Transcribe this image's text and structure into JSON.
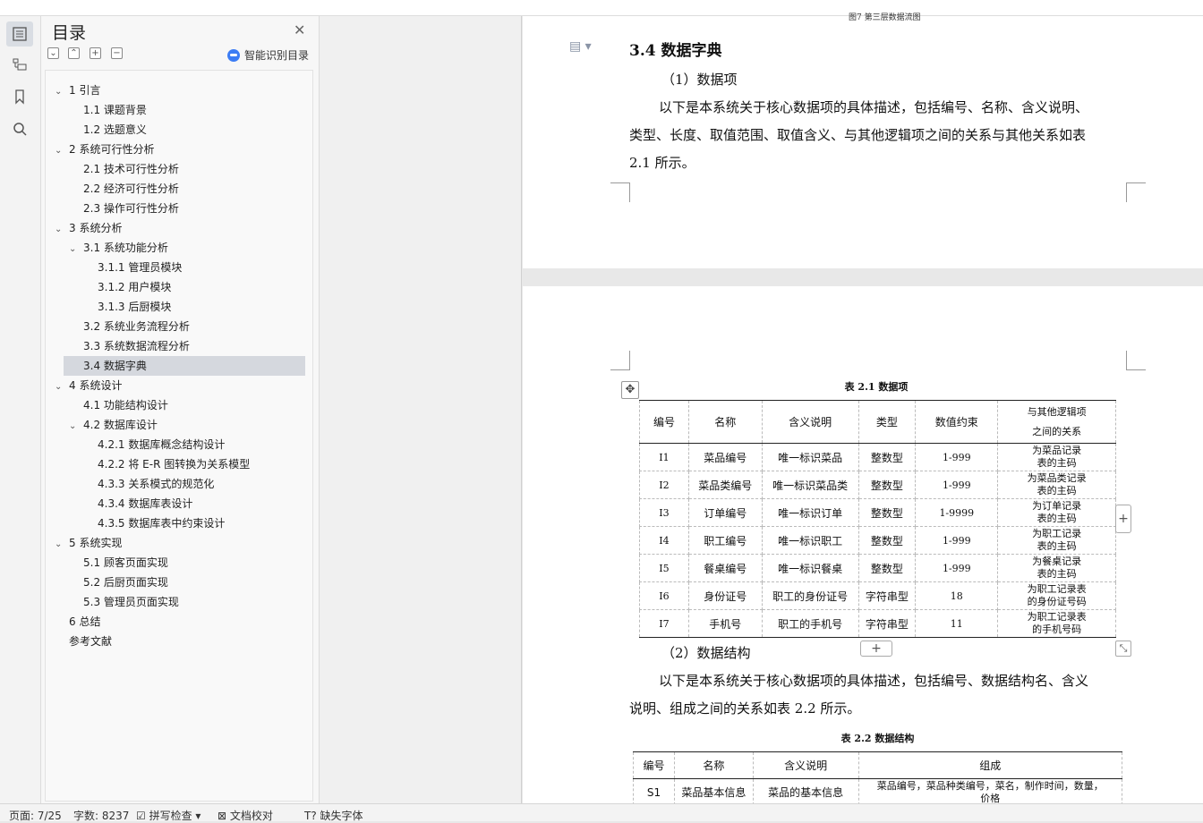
{
  "toc": {
    "title": "目录",
    "smart_label": "智能识别目录",
    "items": [
      {
        "label": "1 引言",
        "level": 1,
        "expanded": true
      },
      {
        "label": "1.1 课题背景",
        "level": 2
      },
      {
        "label": "1.2 选题意义",
        "level": 2
      },
      {
        "label": "2 系统可行性分析",
        "level": 1,
        "expanded": true
      },
      {
        "label": "2.1 技术可行性分析",
        "level": 2
      },
      {
        "label": "2.2 经济可行性分析",
        "level": 2
      },
      {
        "label": "2.3 操作可行性分析",
        "level": 2
      },
      {
        "label": "3 系统分析",
        "level": 1,
        "expanded": true
      },
      {
        "label": "3.1 系统功能分析",
        "level": 2,
        "expanded": true
      },
      {
        "label": "3.1.1 管理员模块",
        "level": 3
      },
      {
        "label": "3.1.2 用户模块",
        "level": 3
      },
      {
        "label": "3.1.3 后厨模块",
        "level": 3
      },
      {
        "label": "3.2 系统业务流程分析",
        "level": 2
      },
      {
        "label": "3.3 系统数据流程分析",
        "level": 2
      },
      {
        "label": "3.4 数据字典",
        "level": 2,
        "selected": true
      },
      {
        "label": "4 系统设计",
        "level": 1,
        "expanded": true
      },
      {
        "label": "4.1 功能结构设计",
        "level": 2
      },
      {
        "label": "4.2 数据库设计",
        "level": 2,
        "expanded": true
      },
      {
        "label": "4.2.1 数据库概念结构设计",
        "level": 3
      },
      {
        "label": "4.2.2 将 E-R 图转换为关系模型",
        "level": 3
      },
      {
        "label": "4.3.3 关系模式的规范化",
        "level": 3
      },
      {
        "label": "4.3.4 数据库表设计",
        "level": 3
      },
      {
        "label": "4.3.5 数据库表中约束设计",
        "level": 3
      },
      {
        "label": "5 系统实现",
        "level": 1,
        "expanded": true
      },
      {
        "label": "5.1 顾客页面实现",
        "level": 2
      },
      {
        "label": "5.2 后厨页面实现",
        "level": 2
      },
      {
        "label": "5.3 管理员页面实现",
        "level": 2
      },
      {
        "label": "6 总结",
        "level": 1
      },
      {
        "label": "参考文献",
        "level": 1
      }
    ]
  },
  "doc": {
    "top_caption": "图7 第三层数据流图",
    "heading": "3.4  数据字典",
    "sub1": "（1）数据项",
    "para1_lines": [
      "以下是本系统关于核心数据项的具体描述，包括编号、名称、含义说明、",
      "类型、长度、取值范围、取值含义、与其他逻辑项之间的关系与其他关系如表",
      "2.1 所示。"
    ],
    "table1_caption": "表 2.1  数据项",
    "table1_headers": [
      "编号",
      "名称",
      "含义说明",
      "类型",
      "数值约束",
      "与其他逻辑项",
      "之间的关系"
    ],
    "table1_rows": [
      [
        "I1",
        "菜品编号",
        "唯一标识菜品",
        "整数型",
        "1-999",
        "为菜品记录",
        "表的主码"
      ],
      [
        "I2",
        "菜品类编号",
        "唯一标识菜品类",
        "整数型",
        "1-999",
        "为菜品类记录",
        "表的主码"
      ],
      [
        "I3",
        "订单编号",
        "唯一标识订单",
        "整数型",
        "1-9999",
        "为订单记录",
        "表的主码"
      ],
      [
        "I4",
        "职工编号",
        "唯一标识职工",
        "整数型",
        "1-999",
        "为职工记录",
        "表的主码"
      ],
      [
        "I5",
        "餐桌编号",
        "唯一标识餐桌",
        "整数型",
        "1-999",
        "为餐桌记录",
        "表的主码"
      ],
      [
        "I6",
        "身份证号",
        "职工的身份证号",
        "字符串型",
        "18",
        "为职工记录表",
        "的身份证号码"
      ],
      [
        "I7",
        "手机号",
        "职工的手机号",
        "字符串型",
        "11",
        "为职工记录表",
        "的手机号码"
      ]
    ],
    "sub2": "（2）数据结构",
    "para2_lines": [
      "以下是本系统关于核心数据项的具体描述，包括编号、数据结构名、含义",
      "说明、组成之间的关系如表 2.2 所示。"
    ],
    "table2_caption": "表 2.2 数据结构",
    "table2_headers": [
      "编号",
      "名称",
      "含义说明",
      "组成"
    ],
    "table2_rows": [
      [
        "S1",
        "菜品基本信息",
        "菜品的基本信息",
        "菜品编号，菜品种类编号，菜名，制作时间，数量，",
        "价格"
      ]
    ]
  },
  "status": {
    "page": "页面: 7/25",
    "words": "字数: 8237",
    "spell": "拼写检查",
    "proof": "文档校对",
    "font": "缺失字体"
  },
  "colors": {
    "selected_bg": "#d5d8de",
    "accent": "#3b7cf4"
  }
}
